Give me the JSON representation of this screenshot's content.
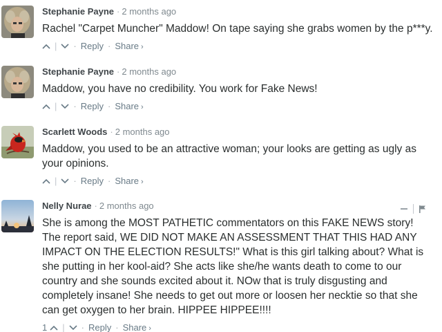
{
  "comments": [
    {
      "author": "Stephanie Payne",
      "time": "2 months ago",
      "lines": [
        "Rachel \"Carpet Muncher\" Maddow! On tape saying she grabs women by the p***y."
      ],
      "reply_label": "Reply",
      "share_label": "Share",
      "avatar": "curly-hair-woman-avatar"
    },
    {
      "author": "Stephanie Payne",
      "time": "2 months ago",
      "lines": [
        "Maddow, you have no credibility. You work for Fake News!"
      ],
      "reply_label": "Reply",
      "share_label": "Share",
      "avatar": "curly-hair-woman-avatar"
    },
    {
      "author": "Scarlett Woods",
      "time": "2 months ago",
      "lines": [
        "Maddow, you used to be an attractive woman; your looks are getting as ugly as your opinions."
      ],
      "reply_label": "Reply",
      "share_label": "Share",
      "avatar": "red-cardinal-avatar"
    },
    {
      "author": "Nelly Nurae",
      "time": "2 months ago",
      "lines": [
        "She is among the MOST PATHETIC commentators on this FAKE NEWS story!",
        "The report said, WE DID NOT MAKE AN ASSESSMENT THAT THIS HAD ANY IMPACT ON THE ELECTION RESULTS!\" What is this girl talking about? What is she putting in her kool-aid? She acts like she/he wants death to come to our country and she sounds excited about it. NOw that is truly disgusting and completely insane! She needs to get out more or loosen her necktie so that she can get oxygen to her brain. HIPPEE HIPPEE!!!!"
      ],
      "upvotes": "1",
      "reply_label": "Reply",
      "share_label": "Share",
      "avatar": "sunset-landscape-avatar"
    }
  ],
  "icons": {
    "upvote": "chevron-up-icon",
    "downvote": "chevron-down-icon",
    "share_chevron": "chevron-right-icon",
    "collapse": "minus-icon",
    "flag": "flag-icon"
  },
  "colors": {
    "author": "#3f4549",
    "meta": "#7f898f",
    "text": "#2a2e2e",
    "actions": "#687a86"
  }
}
